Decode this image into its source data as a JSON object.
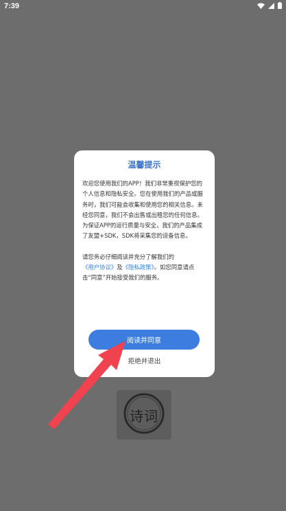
{
  "status_bar": {
    "time": "7:39",
    "icons": [
      "wifi-icon",
      "signal-icon",
      "battery-icon"
    ]
  },
  "background_logo": {
    "text": "诗词"
  },
  "dialog": {
    "title": "温馨提示",
    "paragraph1": "欢迎您使用我们的APP！我们非常重视保护您的个人信息和隐私安全。您在使用我们的产品或服务时，我们可能会收集和使用您的相关信息。未经您同意，我们不会出售或出租您的任何信息。为保证APP的运行质量与安全，我们的产品集成了友盟+SDK，SDK将采集您的设备信息。",
    "paragraph2_prefix": "请您务必仔细阅读并充分了解我们的",
    "user_agreement": "《用户协议》",
    "and": "及",
    "privacy_policy": "《隐私政策》",
    "paragraph2_suffix": "。如您同意请点击“同意”开始接受我们的服务。",
    "agree_label": "阅读并同意",
    "refuse_label": "拒绝并退出"
  },
  "colors": {
    "overlay": "#6d6d6d",
    "accent": "#3d7de0",
    "link": "#2f82e8",
    "title": "#3b74c8",
    "arrow": "#f0434f"
  }
}
